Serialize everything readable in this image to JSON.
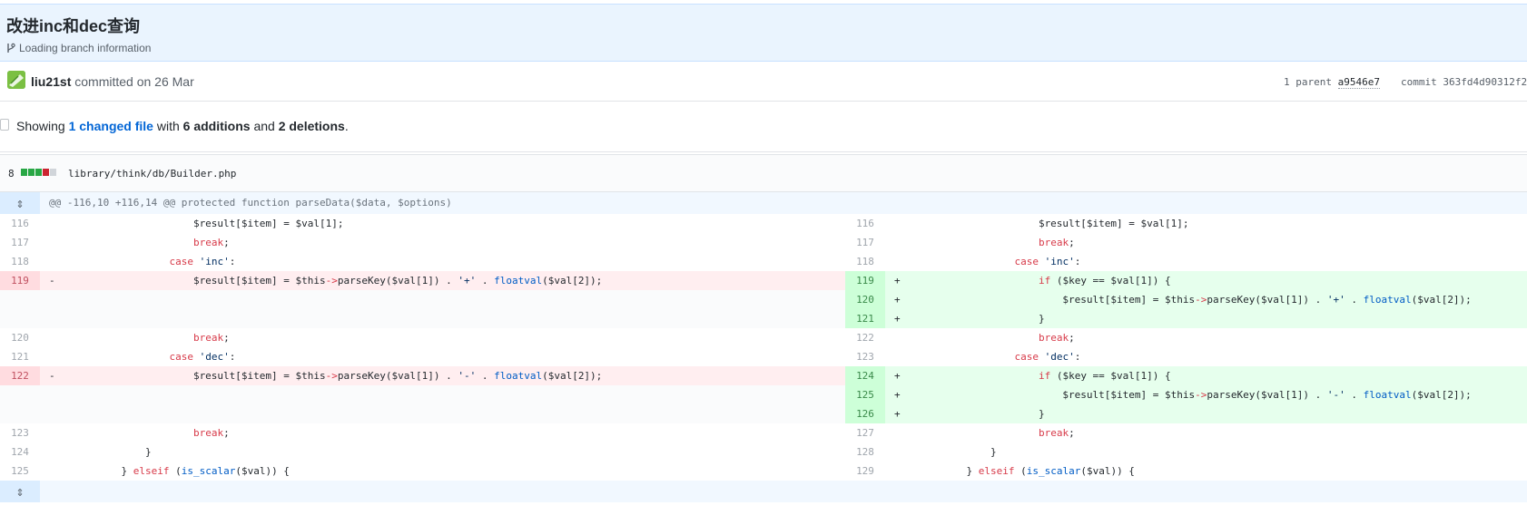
{
  "commit": {
    "title": "改进inc和dec查询",
    "branch_info": "Loading branch information",
    "author": "liu21st",
    "committed_text": "committed on 26 Mar",
    "parent_label": "1 parent",
    "parent_sha": "a9546e7",
    "commit_label": "commit",
    "commit_sha": "363fd4d90312f2"
  },
  "summary": {
    "showing": "Showing",
    "changed": "1 changed file",
    "with": "with",
    "additions": "6 additions",
    "and": "and",
    "deletions": "2 deletions",
    "end": "."
  },
  "file": {
    "count": "8",
    "path": "library/think/db/Builder.php",
    "diffstat": [
      "#28a745",
      "#28a745",
      "#28a745",
      "#cb2431",
      "#d1d5da"
    ]
  },
  "hunks": {
    "header": "@@ -116,10 +116,14 @@ protected function parseData($data, $options)"
  },
  "lines": [
    {
      "ln": "116",
      "rn": "116",
      "type": "ctx",
      "l": "                        $result[$item] = $val[1];",
      "r": "                        $result[$item] = $val[1];"
    },
    {
      "ln": "117",
      "rn": "117",
      "type": "ctx",
      "l": "                        break;",
      "r": "                        break;"
    },
    {
      "ln": "118",
      "rn": "118",
      "type": "ctx",
      "l": "                    case 'inc':",
      "r": "                    case 'inc':"
    },
    {
      "ln": "119",
      "rn": "119",
      "type": "chg",
      "l": "                        $result[$item] = $this->parseKey($val[1]) . '+' . floatval($val[2]);",
      "r": "                        if ($key == $val[1]) {"
    },
    {
      "ln": "",
      "rn": "120",
      "type": "add",
      "l": "",
      "r": "                            $result[$item] = $this->parseKey($val[1]) . '+' . floatval($val[2]);"
    },
    {
      "ln": "",
      "rn": "121",
      "type": "add",
      "l": "",
      "r": "                        }"
    },
    {
      "ln": "120",
      "rn": "122",
      "type": "ctx",
      "l": "                        break;",
      "r": "                        break;"
    },
    {
      "ln": "121",
      "rn": "123",
      "type": "ctx",
      "l": "                    case 'dec':",
      "r": "                    case 'dec':"
    },
    {
      "ln": "122",
      "rn": "124",
      "type": "chg",
      "l": "                        $result[$item] = $this->parseKey($val[1]) . '-' . floatval($val[2]);",
      "r": "                        if ($key == $val[1]) {"
    },
    {
      "ln": "",
      "rn": "125",
      "type": "add",
      "l": "",
      "r": "                            $result[$item] = $this->parseKey($val[1]) . '-' . floatval($val[2]);"
    },
    {
      "ln": "",
      "rn": "126",
      "type": "add",
      "l": "",
      "r": "                        }"
    },
    {
      "ln": "123",
      "rn": "127",
      "type": "ctx",
      "l": "                        break;",
      "r": "                        break;"
    },
    {
      "ln": "124",
      "rn": "128",
      "type": "ctx",
      "l": "                }",
      "r": "                }"
    },
    {
      "ln": "125",
      "rn": "129",
      "type": "ctx",
      "l": "            } elseif (is_scalar($val)) {",
      "r": "            } elseif (is_scalar($val)) {"
    }
  ],
  "markers": {
    "del": "-",
    "add": "+"
  },
  "icons": {
    "expand": "expand-icon",
    "branch": "git-branch-icon",
    "avatar": "avatar",
    "file": "file-diff-icon"
  }
}
